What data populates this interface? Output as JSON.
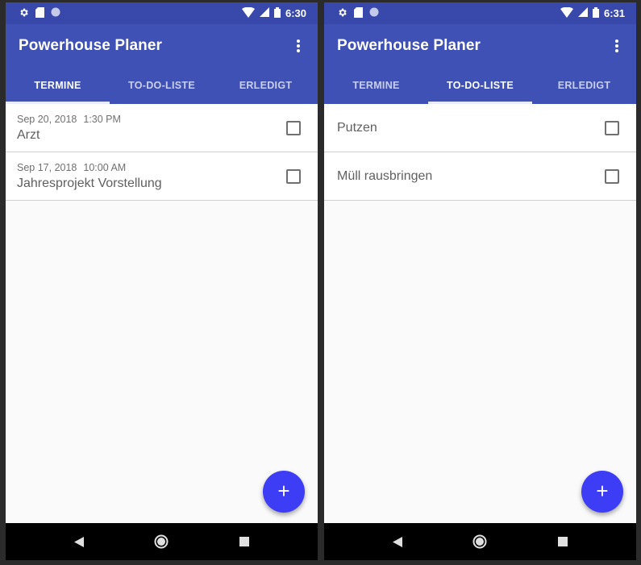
{
  "screens": [
    {
      "status": {
        "time": "6:30"
      },
      "app_title": "Powerhouse Planer",
      "tabs": [
        {
          "label": "TERMINE",
          "active": true
        },
        {
          "label": "TO-DO-LISTE",
          "active": false
        },
        {
          "label": "ERLEDIGT",
          "active": false
        }
      ],
      "items": [
        {
          "date": "Sep 20, 2018",
          "time": "1:30 PM",
          "title": "Arzt",
          "checked": false
        },
        {
          "date": "Sep 17, 2018",
          "time": "10:00 AM",
          "title": "Jahresprojekt Vorstellung",
          "checked": false
        }
      ],
      "fab_label": "+"
    },
    {
      "status": {
        "time": "6:31"
      },
      "app_title": "Powerhouse Planer",
      "tabs": [
        {
          "label": "TERMINE",
          "active": false
        },
        {
          "label": "TO-DO-LISTE",
          "active": true
        },
        {
          "label": "ERLEDIGT",
          "active": false
        }
      ],
      "items": [
        {
          "title": "Putzen",
          "checked": false
        },
        {
          "title": "Müll rausbringen",
          "checked": false
        }
      ],
      "fab_label": "+"
    }
  ],
  "colors": {
    "primary": "#3f51b5",
    "primary_dark": "#3949ab",
    "accent": "#3d3df5",
    "navbar": "#000000"
  },
  "icons": {
    "status_left": [
      "settings-icon",
      "sd-card-icon",
      "circle-icon"
    ],
    "status_right": [
      "wifi-icon",
      "signal-icon",
      "battery-icon"
    ],
    "nav": [
      "back-icon",
      "home-icon",
      "recents-icon"
    ]
  }
}
